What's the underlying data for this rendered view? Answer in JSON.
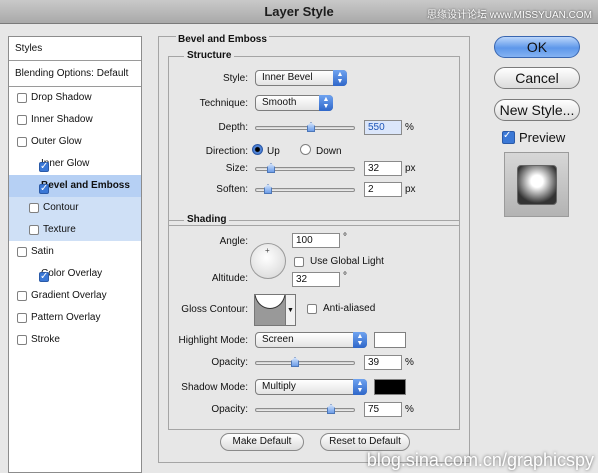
{
  "window": {
    "title": "Layer Style",
    "watermark_top": "思缘设计论坛 www.MISSYUAN.COM",
    "watermark_bottom": "blog.sina.com.cn/graphicspy"
  },
  "sidebar": {
    "header": "Styles",
    "blending": "Blending Options: Default",
    "items": [
      {
        "label": "Drop Shadow",
        "checked": false
      },
      {
        "label": "Inner Shadow",
        "checked": false
      },
      {
        "label": "Outer Glow",
        "checked": false
      },
      {
        "label": "Inner Glow",
        "checked": true
      },
      {
        "label": "Bevel and Emboss",
        "checked": true
      },
      {
        "label": "Contour",
        "checked": false
      },
      {
        "label": "Texture",
        "checked": false
      },
      {
        "label": "Satin",
        "checked": false
      },
      {
        "label": "Color Overlay",
        "checked": true
      },
      {
        "label": "Gradient Overlay",
        "checked": false
      },
      {
        "label": "Pattern Overlay",
        "checked": false
      },
      {
        "label": "Stroke",
        "checked": false
      }
    ]
  },
  "bevel": {
    "section_title": "Bevel and Emboss",
    "structure_title": "Structure",
    "style_label": "Style:",
    "style_value": "Inner Bevel",
    "technique_label": "Technique:",
    "technique_value": "Smooth",
    "depth_label": "Depth:",
    "depth_value": "550",
    "depth_unit": "%",
    "direction_label": "Direction:",
    "direction_up": "Up",
    "direction_down": "Down",
    "direction_selected": "Up",
    "size_label": "Size:",
    "size_value": "32",
    "size_unit": "px",
    "soften_label": "Soften:",
    "soften_value": "2",
    "soften_unit": "px"
  },
  "shading": {
    "title": "Shading",
    "angle_label": "Angle:",
    "angle_value": "100",
    "angle_unit": "°",
    "global_light_label": "Use Global Light",
    "global_light_checked": false,
    "altitude_label": "Altitude:",
    "altitude_value": "32",
    "altitude_unit": "°",
    "gloss_label": "Gloss Contour:",
    "anti_aliased_label": "Anti-aliased",
    "anti_aliased_checked": false,
    "highlight_mode_label": "Highlight Mode:",
    "highlight_mode_value": "Screen",
    "highlight_color": "#ffffff",
    "highlight_opacity_label": "Opacity:",
    "highlight_opacity_value": "39",
    "highlight_opacity_unit": "%",
    "shadow_mode_label": "Shadow Mode:",
    "shadow_mode_value": "Multiply",
    "shadow_color": "#000000",
    "shadow_opacity_label": "Opacity:",
    "shadow_opacity_value": "75",
    "shadow_opacity_unit": "%"
  },
  "footer": {
    "make_default": "Make Default",
    "reset_default": "Reset to Default"
  },
  "actions": {
    "ok": "OK",
    "cancel": "Cancel",
    "new_style": "New Style...",
    "preview_label": "Preview",
    "preview_checked": true
  }
}
